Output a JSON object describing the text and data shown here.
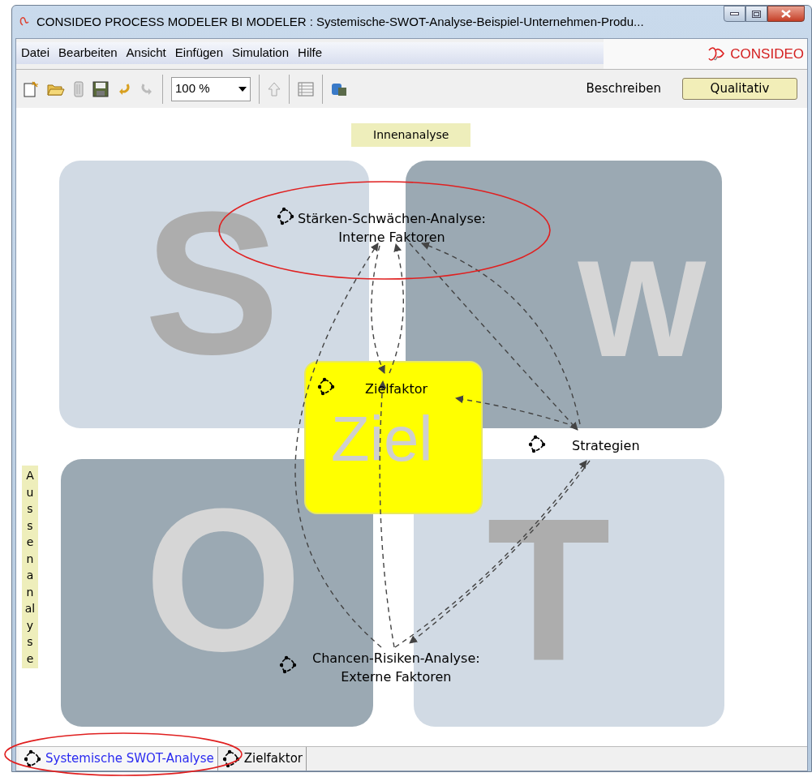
{
  "window": {
    "title": "CONSIDEO PROCESS MODELER BI MODELER : Systemische-SWOT-Analyse-Beispiel-Unternehmen-Produ..."
  },
  "menu": [
    "Datei",
    "Bearbeiten",
    "Ansicht",
    "Einfügen",
    "Simulation",
    "Hilfe"
  ],
  "logo": {
    "text": "CONSIDEO"
  },
  "toolbar": {
    "zoom": "100 %",
    "modes": [
      {
        "label": "Beschreiben",
        "selected": false
      },
      {
        "label": "Qualitativ",
        "selected": true
      }
    ]
  },
  "canvas": {
    "top_label": "Innenanalyse",
    "side_label": "Aussenanalyse",
    "quadrants": [
      {
        "letter": "S",
        "color": "#d1dae4"
      },
      {
        "letter": "W",
        "color": "#9ba9b3"
      },
      {
        "letter": "O",
        "color": "#9ba9b3"
      },
      {
        "letter": "T",
        "color": "#d1dae4"
      }
    ],
    "center": {
      "letter": "Ziel"
    },
    "nodes": [
      {
        "lines": [
          "Stärken-Schwächen-Analyse:",
          "Interne Faktoren"
        ],
        "highlighted": true
      },
      {
        "lines": [
          "Zielfaktor"
        ],
        "highlighted": false
      },
      {
        "lines": [
          "Strategien"
        ],
        "highlighted": false
      },
      {
        "lines": [
          "Chancen-Risiken-Analyse:",
          "Externe Faktoren"
        ],
        "highlighted": false
      }
    ]
  },
  "tabs": [
    {
      "label": "Systemische SWOT-Analyse",
      "selected": true,
      "highlighted": true
    },
    {
      "label": "Zielfaktor",
      "selected": false,
      "highlighted": false
    }
  ]
}
